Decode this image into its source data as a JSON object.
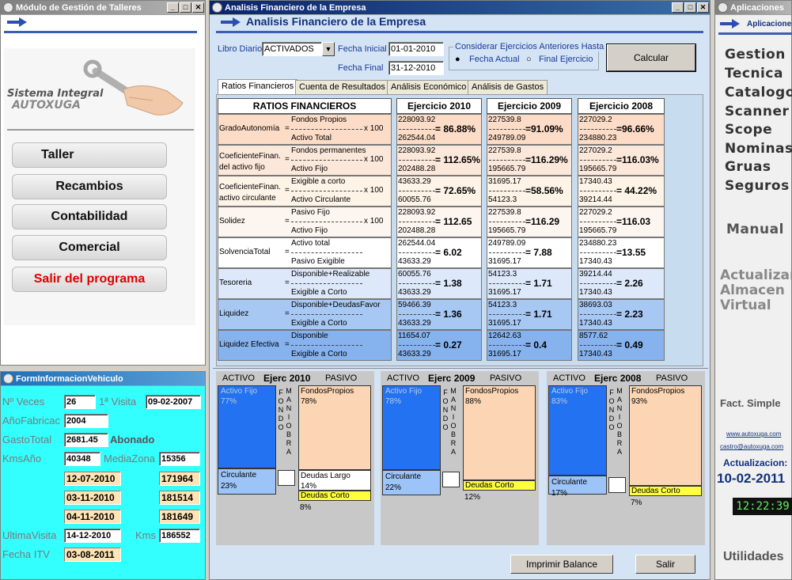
{
  "left_window": {
    "title": "Módulo de Gestión de Talleres",
    "logo_line1": "Sistema Integral",
    "logo_line2": "AUTOXUGA",
    "buttons": [
      "Taller",
      "Recambios",
      "Contabilidad",
      "Comercial",
      "Salir del programa"
    ]
  },
  "vehicle_window": {
    "title": "FormInformacionVehiculo",
    "num_veces_label": "Nº Veces",
    "num_veces": "26",
    "primera_visita_label": "1ª Visita",
    "primera_visita": "09-02-2007",
    "anio_label": "AñoFabricac",
    "anio": "2004",
    "gasto_label": "GastoTotal",
    "gasto": "2681.45",
    "abonado": "Abonado",
    "kms_anio_label": "KmsAño",
    "kms_anio": "40348",
    "media_zona_label": "MediaZona",
    "media_zona": "15356",
    "visits": [
      {
        "date": "12-07-2010",
        "km": "171964"
      },
      {
        "date": "03-11-2010",
        "km": "181514"
      },
      {
        "date": "04-11-2010",
        "km": "181649"
      }
    ],
    "ultima_label": "UltimaVisita",
    "ultima": "14-12-2010",
    "kms_label": "Kms",
    "kms": "186552",
    "itv_label": "Fecha ITV",
    "itv": "03-08-2011"
  },
  "main_window": {
    "title": "Analisis Financiero de la Empresa",
    "header": "Analisis Financiero de la Empresa",
    "libro_label": "Libro Diario",
    "libro_value": "ACTIVADOS",
    "fecha_inicial_label": "Fecha Inicial",
    "fecha_inicial": "01-01-2010",
    "fecha_final_label": "Fecha Final",
    "fecha_final": "31-12-2010",
    "considerar_label": "Considerar Ejercicios Anteriores Hasta",
    "radio1": "Fecha Actual",
    "radio2": "Final Ejercicio",
    "calcular": "Calcular",
    "tabs": [
      "Ratios Financieros",
      "Cuenta de Resultados",
      "Análisis Económico",
      "Análisis de Gastos"
    ],
    "ratios_header": "RATIOS FINANCIEROS",
    "year_headers": [
      "Ejercicio 2010",
      "Ejercicio 2009",
      "Ejercicio 2008"
    ],
    "ratios": [
      {
        "name": "GradoAutonomía",
        "name2": "",
        "num": "Fondos Propios",
        "den": "Activo Total",
        "x100": "x 100",
        "vals": [
          [
            "228093.92",
            "262544.04",
            "= 86.88%"
          ],
          [
            "227539.8",
            "249789.09",
            "=91.09%"
          ],
          [
            "227029.2",
            "234880.23",
            "=96.66%"
          ]
        ]
      },
      {
        "name": "CoeficienteFinan.",
        "name2": "del activo fijo",
        "num": "Fondos permanentes",
        "den": "Activo Fijo",
        "x100": "x 100",
        "vals": [
          [
            "228093.92",
            "202488.28",
            "= 112.65%"
          ],
          [
            "227539.8",
            "195665.79",
            "=116.29%"
          ],
          [
            "227029.2",
            "195665.79",
            "=116.03%"
          ]
        ]
      },
      {
        "name": "CoeficienteFinan.",
        "name2": "activo circulante",
        "num": "Exigible a corto",
        "den": "Activo Circulante",
        "x100": "x 100",
        "vals": [
          [
            "43633.29",
            "60055.76",
            "= 72.65%"
          ],
          [
            "31695.17",
            "54123.3",
            "=58.56%"
          ],
          [
            "17340.43",
            "39214.44",
            "= 44.22%"
          ]
        ]
      },
      {
        "name": "Solidez",
        "name2": "",
        "num": "Pasivo Fijo",
        "den": "Activo Fijo",
        "x100": "x 100",
        "vals": [
          [
            "228093.92",
            "202488.28",
            "= 112.65"
          ],
          [
            "227539.8",
            "195665.79",
            "=116.29"
          ],
          [
            "227029.2",
            "195665.79",
            "=116.03"
          ]
        ]
      },
      {
        "name": "SolvenciaTotal",
        "name2": "",
        "num": "Activo total",
        "den": "Pasivo Exigible",
        "x100": "",
        "vals": [
          [
            "262544.04",
            "43633.29",
            "= 6.02"
          ],
          [
            "249789.09",
            "31695.17",
            "= 7.88"
          ],
          [
            "234880.23",
            "17340.43",
            "=13.55"
          ]
        ]
      },
      {
        "name": "Tesoreria",
        "name2": "",
        "num": "Disponible+Realizable",
        "den": "Exigible a Corto",
        "x100": "",
        "vals": [
          [
            "60055.76",
            "43633.29",
            "= 1.38"
          ],
          [
            "54123.3",
            "31695.17",
            "= 1.71"
          ],
          [
            "39214.44",
            "17340.43",
            "= 2.26"
          ]
        ]
      },
      {
        "name": "Liquidez",
        "name2": "",
        "num": "Disponible+DeudasFavor",
        "den": "Exigible a Corto",
        "x100": "",
        "vals": [
          [
            "59466.39",
            "43633.29",
            "= 1.36"
          ],
          [
            "54123.3",
            "31695.17",
            "= 1.71"
          ],
          [
            "38693.03",
            "17340.43",
            "= 2.23"
          ]
        ]
      },
      {
        "name": "Liquidez Efectiva",
        "name2": "",
        "num": "Disponible",
        "den": "Exigible a Corto",
        "x100": "",
        "vals": [
          [
            "11654.07",
            "43633.29",
            "= 0.27"
          ],
          [
            "12642.63",
            "31695.17",
            "= 0.4"
          ],
          [
            "8577.62",
            "17340.43",
            "= 0.49"
          ]
        ]
      }
    ],
    "balances": [
      {
        "activo": "ACTIVO",
        "ejerc": "Ejerc 2010",
        "pasivo": "PASIVO",
        "fijo_label": "Activo Fijo",
        "fijo_pct": "77%",
        "circ_label": "Circulante",
        "circ_pct": "23%",
        "fondos_label": "FondosPropios",
        "fondos_pct": "78%",
        "largo_label": "Deudas Largo",
        "largo_pct": "14%",
        "corto_label": "Deudas Corto",
        "corto_pct": "8%",
        "fijo": 0.77,
        "circ": 0.23,
        "fondos": 0.78,
        "largo": 0.14,
        "corto": 0.08
      },
      {
        "activo": "ACTIVO",
        "ejerc": "Ejerc 2009",
        "pasivo": "PASIVO",
        "fijo_label": "Activo Fijo",
        "fijo_pct": "78%",
        "circ_label": "Circulante",
        "circ_pct": "22%",
        "fondos_label": "FondosPropios",
        "fondos_pct": "88%",
        "largo_label": "",
        "largo_pct": "",
        "corto_label": "Deudas Corto",
        "corto_pct": "12%",
        "fijo": 0.78,
        "circ": 0.22,
        "fondos": 0.88,
        "largo": 0,
        "corto": 0.12
      },
      {
        "activo": "ACTIVO",
        "ejerc": "Ejerc 2008",
        "pasivo": "PASIVO",
        "fijo_label": "Activo Fijo",
        "fijo_pct": "83%",
        "circ_label": "Circulante",
        "circ_pct": "17%",
        "fondos_label": "FondosPropios",
        "fondos_pct": "93%",
        "largo_label": "",
        "largo_pct": "",
        "corto_label": "Deudas Corto",
        "corto_pct": "7%",
        "fijo": 0.83,
        "circ": 0.17,
        "fondos": 0.93,
        "largo": 0,
        "corto": 0.07
      }
    ],
    "fondo_maniobra": "FONDO",
    "maniobra": "MANIOBRA",
    "imprimir": "Imprimir Balance",
    "salir": "Salir"
  },
  "right_window": {
    "title": "Aplicaciones",
    "header": "Aplicaciones",
    "items": [
      "Gestion",
      "Tecnica",
      "Catalogos",
      "Scanner",
      "Scope",
      "Nominas",
      "Gruas",
      "Seguros"
    ],
    "manual": "Manual",
    "actualizar": [
      "Actualizar",
      "Almacen",
      "Virtual"
    ],
    "fact": "Fact. Simple",
    "link1": "www.autoxuga.com",
    "link2": "castro@autoxuga.com",
    "actualizacion_label": "Actualizacion:",
    "actualizacion_date": "10-02-2011",
    "clock": "12:22:39",
    "utilidades": "Utilidades"
  },
  "colors": {
    "row_colors": [
      "#fcdcc6",
      "#fce8da",
      "#fdf3e6",
      "#fdf6f0",
      "#ffffff",
      "#dde9fb",
      "#a8c8f4",
      "#86b2ee"
    ],
    "blue": "#2272f2",
    "lightblue": "#9cc4f8",
    "peach": "#fcd6b4",
    "yellow": "#ffff40",
    "cyan": "#33ffff"
  }
}
